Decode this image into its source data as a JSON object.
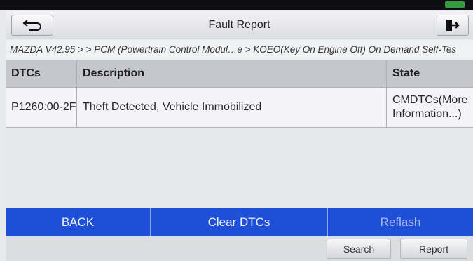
{
  "header": {
    "title": "Fault Report",
    "back_icon": "back-arrow-icon",
    "exit_icon": "exit-icon"
  },
  "breadcrumb": "MAZDA V42.95 > > PCM (Powertrain Control Modul…e > KOEO(Key On Engine Off) On Demand Self-Tes",
  "table": {
    "columns": [
      "DTCs",
      "Description",
      "State"
    ],
    "rows": [
      {
        "code": "P1260:00-2F",
        "description": "Theft Detected, Vehicle Immobilized",
        "state": "CMDTCs(More Information...)"
      }
    ]
  },
  "actions": {
    "back": "BACK",
    "clear": "Clear DTCs",
    "reflash": "Reflash"
  },
  "footer": {
    "search": "Search",
    "report": "Report"
  },
  "colors": {
    "action_bar": "#1f4fd6",
    "header_row": "#c5c7cc"
  }
}
